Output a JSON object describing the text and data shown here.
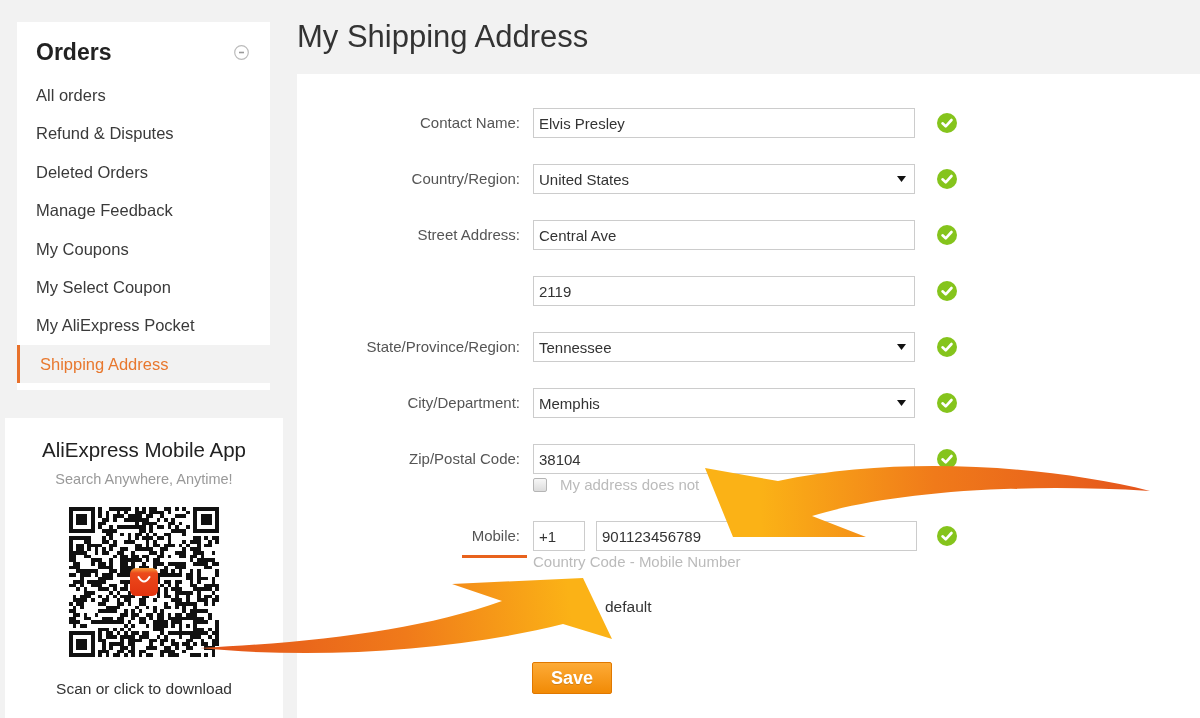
{
  "sidebar": {
    "title": "Orders",
    "items": [
      {
        "label": "All orders",
        "selected": false
      },
      {
        "label": "Refund & Disputes",
        "selected": false
      },
      {
        "label": "Deleted Orders",
        "selected": false
      },
      {
        "label": "Manage Feedback",
        "selected": false
      },
      {
        "label": "My Coupons",
        "selected": false
      },
      {
        "label": "My Select Coupon",
        "selected": false
      },
      {
        "label": "My AliExpress Pocket",
        "selected": false
      },
      {
        "label": "Shipping Address",
        "selected": true
      }
    ]
  },
  "app_promo": {
    "title": "AliExpress Mobile App",
    "subtitle": "Search Anywhere, Anytime!",
    "caption": "Scan or click to download"
  },
  "page_title": "My Shipping Address",
  "form": {
    "fields": [
      {
        "kind": "text",
        "label": "Contact Name:",
        "value": "Elvis Presley",
        "valid": true
      },
      {
        "kind": "select",
        "label": "Country/Region:",
        "value": "United States",
        "valid": true
      },
      {
        "kind": "text",
        "label": "Street Address:",
        "value": "Central Ave",
        "valid": true
      },
      {
        "kind": "text",
        "value": "2119",
        "valid": true
      },
      {
        "kind": "select",
        "label": "State/Province/Region:",
        "value": "Tennessee",
        "valid": true
      },
      {
        "kind": "select",
        "label": "City/Department:",
        "value": "Memphis",
        "valid": true
      },
      {
        "kind": "text",
        "label": "Zip/Postal Code:",
        "value": "38104",
        "valid": true,
        "option": {
          "label": "My address does not",
          "checked": false
        }
      },
      {
        "kind": "phone",
        "label": "Mobile:",
        "code": "+1",
        "value": "901123456789",
        "valid": true,
        "hint": "Country Code - Mobile Number"
      }
    ],
    "default_label": "default",
    "save_button": "Save"
  }
}
